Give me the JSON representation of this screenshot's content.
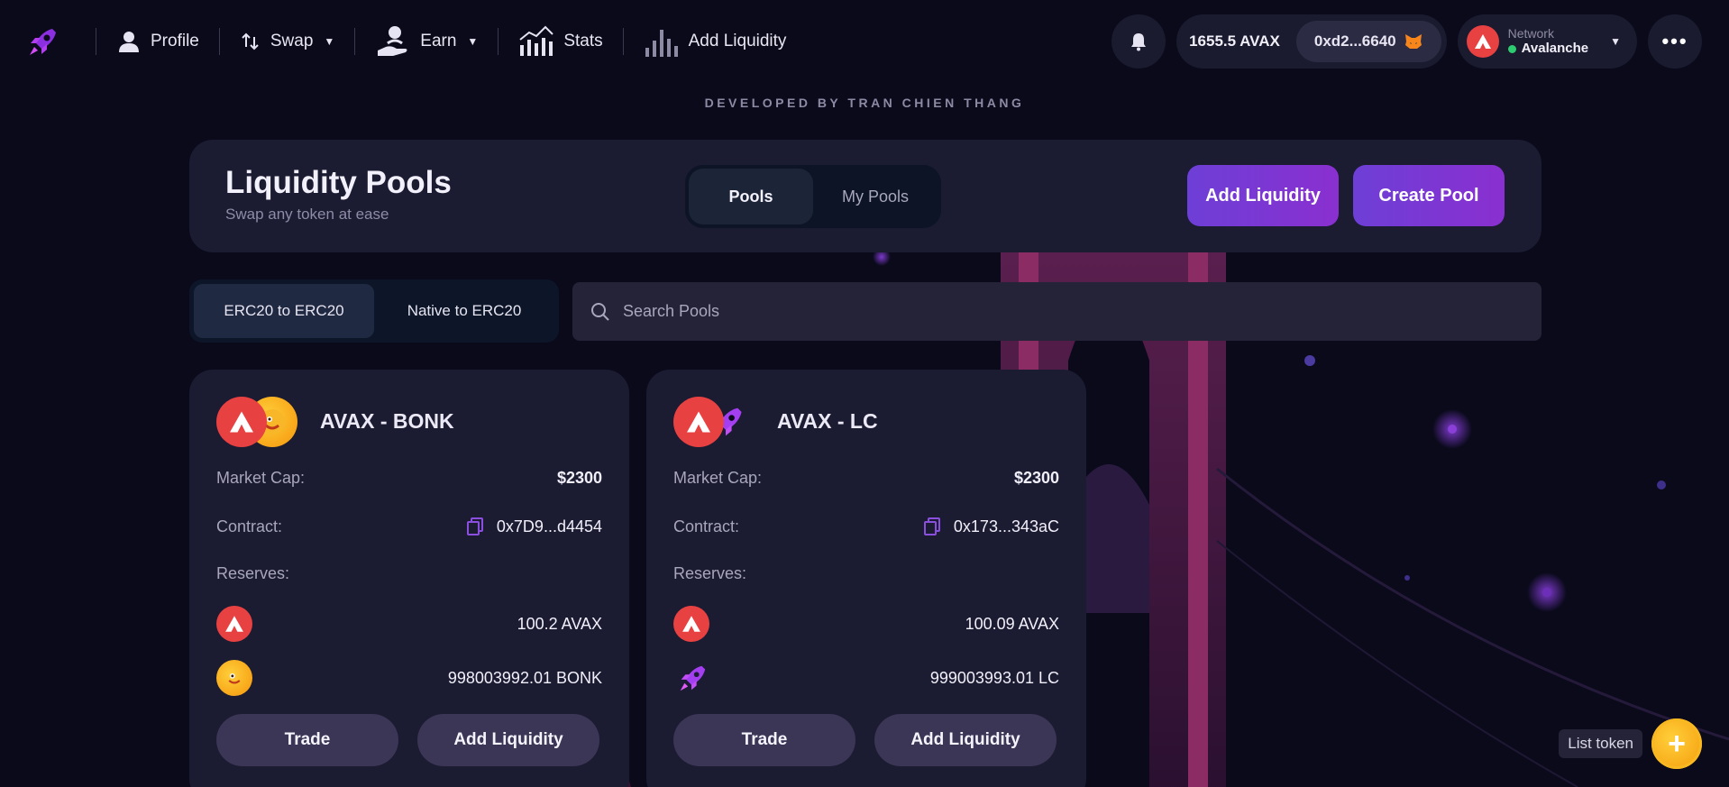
{
  "nav": {
    "items": [
      {
        "label": "Profile",
        "icon": "user-icon"
      },
      {
        "label": "Swap",
        "icon": "swap-arrows-icon"
      },
      {
        "label": "Earn",
        "icon": "hand-user-icon"
      },
      {
        "label": "Stats",
        "icon": "stats-chart-icon"
      },
      {
        "label": "Add Liquidity",
        "icon": "bars-icon"
      }
    ]
  },
  "wallet": {
    "balance": "1655.5 AVAX",
    "address": "0xd2...6640"
  },
  "network": {
    "label": "Network",
    "value": "Avalanche"
  },
  "developer_note": "DEVELOPED BY TRAN CHIEN THANG",
  "header": {
    "title": "Liquidity Pools",
    "subtitle": "Swap any token at ease",
    "tabs": [
      {
        "label": "Pools",
        "active": true
      },
      {
        "label": "My Pools",
        "active": false
      }
    ],
    "add_liquidity_label": "Add Liquidity",
    "create_pool_label": "Create Pool"
  },
  "filters": [
    {
      "label": "ERC20 to ERC20",
      "active": true
    },
    {
      "label": "Native to ERC20",
      "active": false
    }
  ],
  "search": {
    "placeholder": "Search Pools",
    "value": ""
  },
  "pools": [
    {
      "title": "AVAX - BONK",
      "market_cap_label": "Market Cap:",
      "market_cap": "$2300",
      "contract_label": "Contract:",
      "contract": "0x7D9...d4454",
      "reserves_label": "Reserves:",
      "reserve_a": "100.2 AVAX",
      "reserve_b": "998003992.01 BONK",
      "trade_label": "Trade",
      "add_label": "Add Liquidity"
    },
    {
      "title": "AVAX - LC",
      "market_cap_label": "Market Cap:",
      "market_cap": "$2300",
      "contract_label": "Contract:",
      "contract": "0x173...343aC",
      "reserves_label": "Reserves:",
      "reserve_a": "100.09 AVAX",
      "reserve_b": "999003993.01 LC",
      "trade_label": "Trade",
      "add_label": "Add Liquidity"
    }
  ],
  "list_token": {
    "label": "List token",
    "icon": "plus-coin-icon"
  },
  "colors": {
    "accent": "#7b3fe4",
    "avax": "#e84142",
    "bonk": "#f7a21b",
    "background": "#0a0a1b",
    "card": "#1b1b32"
  }
}
